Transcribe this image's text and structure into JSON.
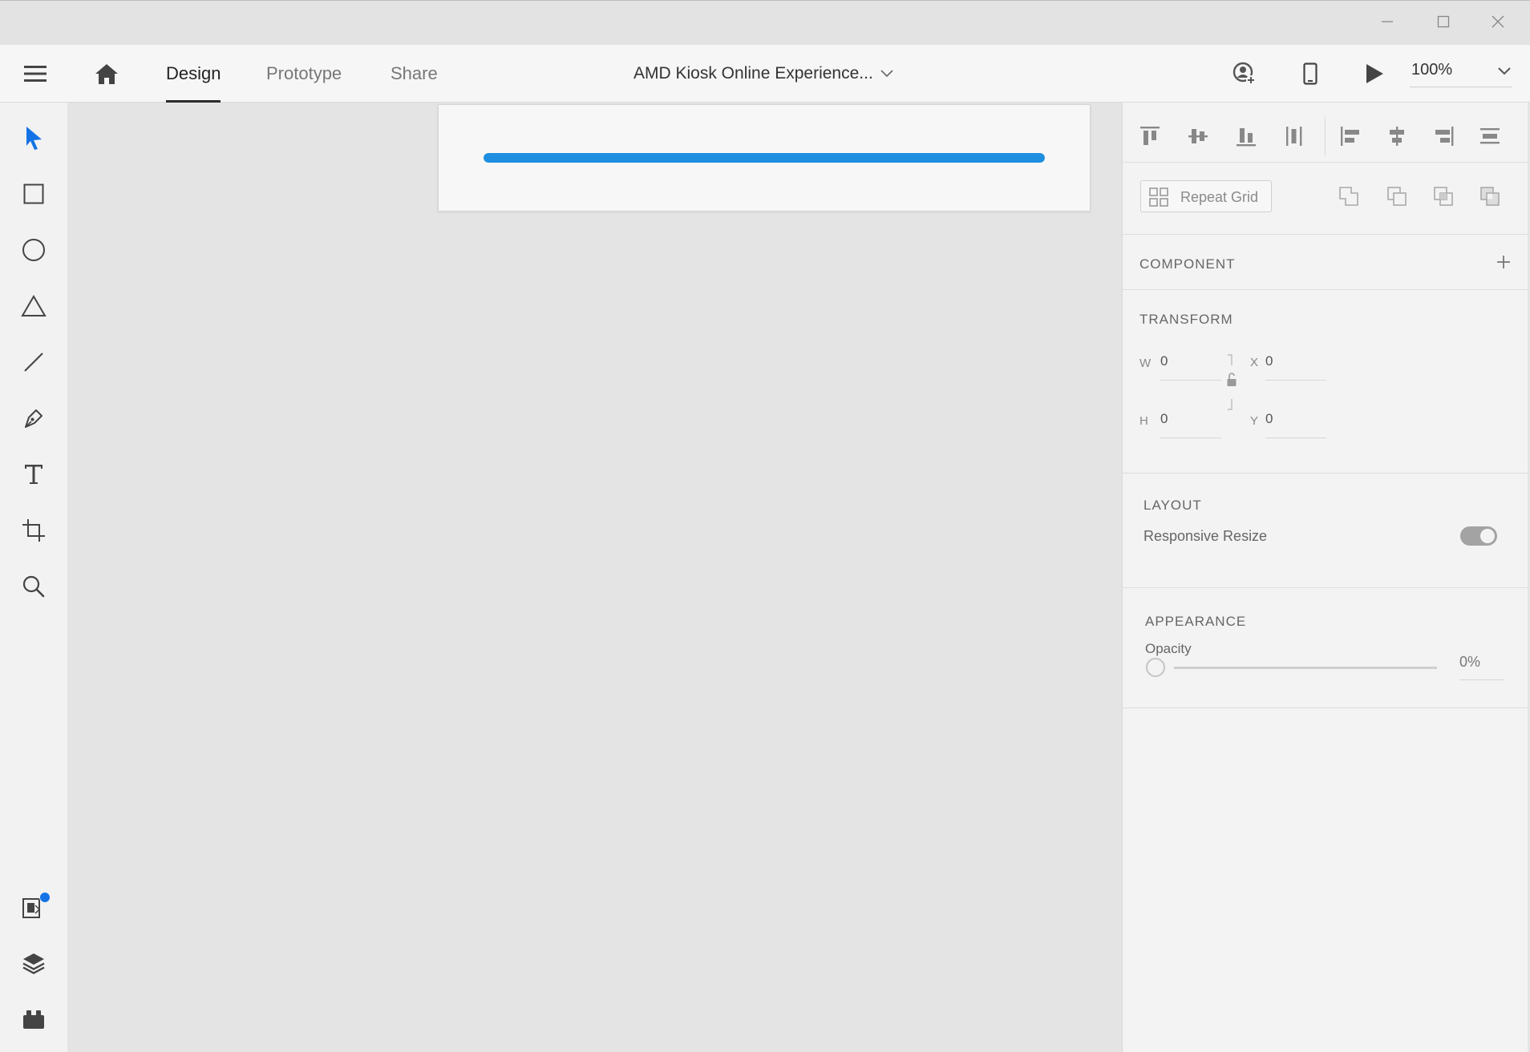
{
  "header": {
    "tabs": [
      {
        "label": "Design",
        "active": true
      },
      {
        "label": "Prototype",
        "active": false
      },
      {
        "label": "Share",
        "active": false
      }
    ],
    "document_title": "AMD Kiosk Online Experience...",
    "zoom": "100%"
  },
  "canvas": {
    "progress_fraction": 1.0,
    "progress_color": "#1e8ee0"
  },
  "inspector": {
    "repeat_grid_label": "Repeat Grid",
    "component": {
      "title": "COMPONENT"
    },
    "transform": {
      "title": "TRANSFORM",
      "w_label": "W",
      "w_value": "0",
      "h_label": "H",
      "h_value": "0",
      "x_label": "X",
      "x_value": "0",
      "y_label": "Y",
      "y_value": "0"
    },
    "layout": {
      "title": "LAYOUT",
      "responsive_resize_label": "Responsive Resize",
      "responsive_resize_on": true
    },
    "appearance": {
      "title": "APPEARANCE",
      "opacity_label": "Opacity",
      "opacity_value": "0%",
      "opacity_fraction": 0.0
    }
  },
  "colors": {
    "accent": "#1e8ee0",
    "notification_dot": "#1473e6",
    "select_tool": "#1473e6"
  },
  "icons": {
    "titlebar": [
      "minimize-icon",
      "maximize-icon",
      "close-icon"
    ],
    "header": [
      "hamburger-menu-icon",
      "home-icon",
      "chevron-down-icon",
      "share-user-icon",
      "mobile-preview-icon",
      "play-icon"
    ],
    "toolbar": [
      "select-arrow-icon",
      "rectangle-icon",
      "ellipse-icon",
      "polygon-icon",
      "line-icon",
      "pen-icon",
      "text-icon",
      "artboard-icon",
      "zoom-icon",
      "assets-icon",
      "layers-icon",
      "plugins-icon"
    ]
  }
}
